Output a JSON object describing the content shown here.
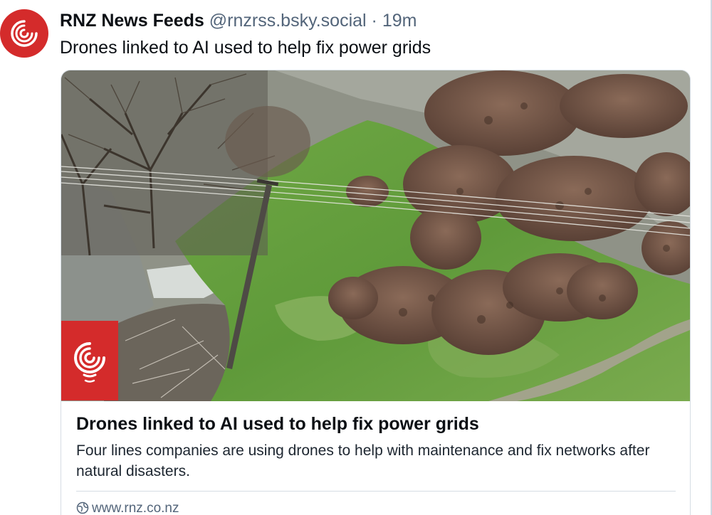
{
  "post": {
    "author_name": "RNZ News Feeds",
    "handle": "@rnzrss.bsky.social",
    "separator": "·",
    "time_ago": "19m",
    "text": "Drones linked to AI used to help fix power grids"
  },
  "link_card": {
    "title": "Drones linked to AI used to help fix power grids",
    "description": "Four lines companies are using drones to help with maintenance and fix networks after natural disasters.",
    "domain": "www.rnz.co.nz",
    "image_icon": "rnz-logo-icon",
    "globe_icon": "globe-icon"
  },
  "colors": {
    "brand_red": "#d42b2b",
    "handle_gray": "#53657a",
    "border": "#d6dde4"
  }
}
